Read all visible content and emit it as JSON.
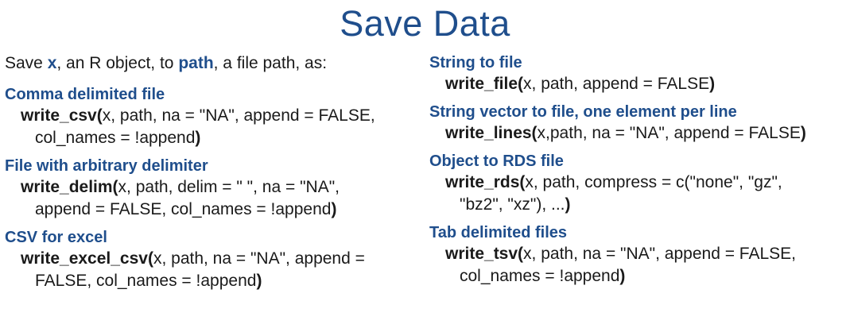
{
  "title": "Save Data",
  "intro": {
    "prefix": "Save ",
    "x": "x",
    "middle": ", an R object, to ",
    "path": "path",
    "suffix": ", a file path, as:"
  },
  "left": [
    {
      "heading": "Comma delimited file",
      "fn": "write_csv(",
      "line1": "x, path, na = \"NA\", append = FALSE,",
      "line2": "col_names = !append",
      "close": ")"
    },
    {
      "heading": "File with arbitrary delimiter",
      "fn": "write_delim(",
      "line1": "x, path, delim = \" \", na = \"NA\",",
      "line2": "append = FALSE, col_names = !append",
      "close": ")"
    },
    {
      "heading": "CSV for excel",
      "fn": "write_excel_csv(",
      "line1": "x, path, na = \"NA\", append =",
      "line2": "FALSE, col_names = !append",
      "close": ")"
    }
  ],
  "right": [
    {
      "heading": "String to file",
      "fn": "write_file(",
      "line1": "x, path, append = FALSE",
      "close": ")"
    },
    {
      "heading": "String vector to file, one element per line",
      "fn": "write_lines(",
      "line1": "x,path, na = \"NA\", append = FALSE",
      "close": ")"
    },
    {
      "heading": "Object to RDS file",
      "fn": "write_rds(",
      "line1": "x, path, compress = c(\"none\", \"gz\",",
      "line2": "\"bz2\", \"xz\"), ...",
      "close": ")"
    },
    {
      "heading": "Tab delimited files",
      "fn": "write_tsv(",
      "line1": "x, path, na = \"NA\", append = FALSE,",
      "line2": "col_names = !append",
      "close": ")"
    }
  ]
}
